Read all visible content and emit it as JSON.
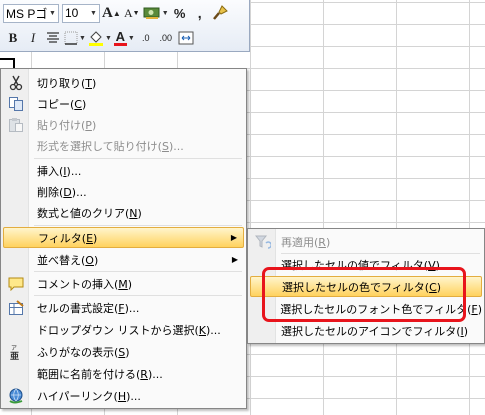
{
  "toolbar": {
    "font_name": "MS Pゴ",
    "font_size": "10",
    "grow_font_label": "A",
    "shrink_font_label": "A",
    "percent_label": "%",
    "comma_label": ",",
    "bold_label": "B",
    "italic_label": "I",
    "font_color_label": "A",
    "inc_decimal_label": ".0",
    "dec_decimal_label": ".00"
  },
  "context_menu": {
    "items": [
      {
        "label": "切り取り(",
        "key": "T",
        "end": ")",
        "icon": "scissors-icon"
      },
      {
        "label": "コピー(",
        "key": "C",
        "end": ")",
        "icon": "copy-icon"
      },
      {
        "label": "貼り付け(",
        "key": "P",
        "end": ")",
        "icon": "paste-icon"
      },
      {
        "label": "形式を選択して貼り付け(",
        "key": "S",
        "end": ")..."
      },
      {
        "label": "挿入(",
        "key": "I",
        "end": ")..."
      },
      {
        "label": "削除(",
        "key": "D",
        "end": ")..."
      },
      {
        "label": "数式と値のクリア(",
        "key": "N",
        "end": ")"
      },
      {
        "label": "フィルタ(",
        "key": "E",
        "end": ")"
      },
      {
        "label": "並べ替え(",
        "key": "O",
        "end": ")"
      },
      {
        "label": "コメントの挿入(",
        "key": "M",
        "end": ")",
        "icon": "insert-comment-icon"
      },
      {
        "label": "セルの書式設定(",
        "key": "F",
        "end": ")...",
        "icon": "format-cells-icon"
      },
      {
        "label": "ドロップダウン リストから選択(",
        "key": "K",
        "end": ")..."
      },
      {
        "label": "ふりがなの表示(",
        "key": "S",
        "end": ")",
        "icon": "furigana-icon"
      },
      {
        "label": "範囲に名前を付ける(",
        "key": "R",
        "end": ")..."
      },
      {
        "label": "ハイパーリンク(",
        "key": "H",
        "end": ")...",
        "icon": "hyperlink-icon"
      }
    ]
  },
  "filter_submenu": {
    "items": [
      {
        "label": "再適用(",
        "key": "R",
        "end": ")",
        "icon": "reapply-filter-icon"
      },
      {
        "label": "選択したセルの値でフィルタ(",
        "key": "V",
        "end": ")"
      },
      {
        "label": "選択したセルの色でフィルタ(",
        "key": "C",
        "end": ")"
      },
      {
        "label": "選択したセルのフォント色でフィルタ(",
        "key": "F",
        "end": ")"
      },
      {
        "label": "選択したセルのアイコンでフィルタ(",
        "key": "I",
        "end": ")"
      }
    ]
  },
  "colors": {
    "highlight_border": "#e8141c",
    "hover_top": "#fff5cc",
    "hover_bottom": "#ffd25e"
  }
}
